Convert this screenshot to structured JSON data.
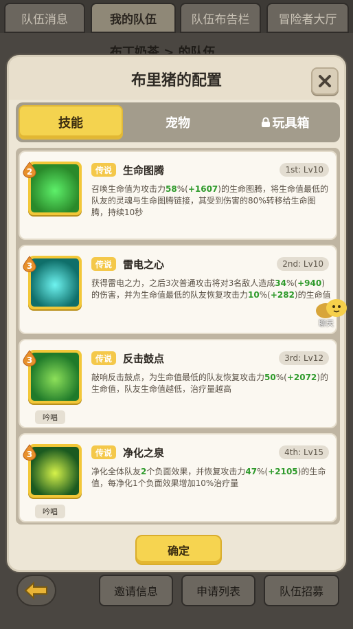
{
  "background": {
    "tabs": [
      "队伍消息",
      "我的队伍",
      "队伍布告栏",
      "冒险者大厅"
    ],
    "active_tab": 1,
    "title_peek": "布丁奶茶 > 的队伍",
    "bottom_buttons": [
      "邀请信息",
      "申请列表",
      "队伍招募"
    ]
  },
  "modal": {
    "title": "布里猪的配置",
    "tabs": [
      {
        "label": "技能",
        "active": true,
        "locked": false
      },
      {
        "label": "宠物",
        "active": false,
        "locked": false
      },
      {
        "label": "玩具箱",
        "active": false,
        "locked": true
      }
    ],
    "skills": [
      {
        "level": "2",
        "rarity": "传说",
        "name": "生命图腾",
        "slot": "1st: Lv10",
        "chant": "",
        "desc": [
          {
            "t": "召唤生命值为攻击力"
          },
          {
            "t": "58",
            "c": "g"
          },
          {
            "t": "%("
          },
          {
            "t": "+1607",
            "c": "g"
          },
          {
            "t": ")的生命图腾，将生命值最低的队友的灵魂与生命图腾链接，其受到伤害的80%转移给生命图腾，持续10秒"
          }
        ],
        "icon_colors": [
          "#2a8a2a",
          "#5ef06a"
        ]
      },
      {
        "level": "3",
        "rarity": "传说",
        "name": "雷电之心",
        "slot": "2nd: Lv10",
        "chant": "",
        "desc": [
          {
            "t": "获得雷电之力，之后3次普通攻击将对3名敌人造成"
          },
          {
            "t": "34",
            "c": "g"
          },
          {
            "t": "%("
          },
          {
            "t": "+940",
            "c": "g"
          },
          {
            "t": ")的伤害，并为生命值最低的队友恢复攻击力"
          },
          {
            "t": "10",
            "c": "g"
          },
          {
            "t": "%("
          },
          {
            "t": "+282",
            "c": "g"
          },
          {
            "t": ")的生命值"
          }
        ],
        "icon_colors": [
          "#0f6f6a",
          "#6ef3f0"
        ]
      },
      {
        "level": "3",
        "rarity": "传说",
        "name": "反击鼓点",
        "slot": "3rd: Lv12",
        "chant": "吟唱",
        "desc": [
          {
            "t": "敲响反击鼓点，为生命值最低的队友恢复攻击力"
          },
          {
            "t": "50",
            "c": "g"
          },
          {
            "t": "%("
          },
          {
            "t": "+2072",
            "c": "g"
          },
          {
            "t": ")的生命值，队友生命值越低，治疗量越高"
          }
        ],
        "icon_colors": [
          "#1f7a2a",
          "#8de05a"
        ]
      },
      {
        "level": "3",
        "rarity": "传说",
        "name": "净化之泉",
        "slot": "4th: Lv15",
        "chant": "吟唱",
        "desc": [
          {
            "t": "净化全体队友"
          },
          {
            "t": "2",
            "c": "g"
          },
          {
            "t": "个负面效果，并恢复攻击力"
          },
          {
            "t": "47",
            "c": "g"
          },
          {
            "t": "%("
          },
          {
            "t": "+2105",
            "c": "g"
          },
          {
            "t": ")的生命值，每净化1个负面效果增加10%治疗量"
          }
        ],
        "icon_colors": [
          "#1b5a20",
          "#d6f24a"
        ]
      }
    ],
    "confirm_label": "确定"
  },
  "chat_label": "聊天",
  "colors": {
    "accent": "#f4d34f",
    "green_value": "#2e9a2b",
    "rarity": "#f4c84a"
  }
}
